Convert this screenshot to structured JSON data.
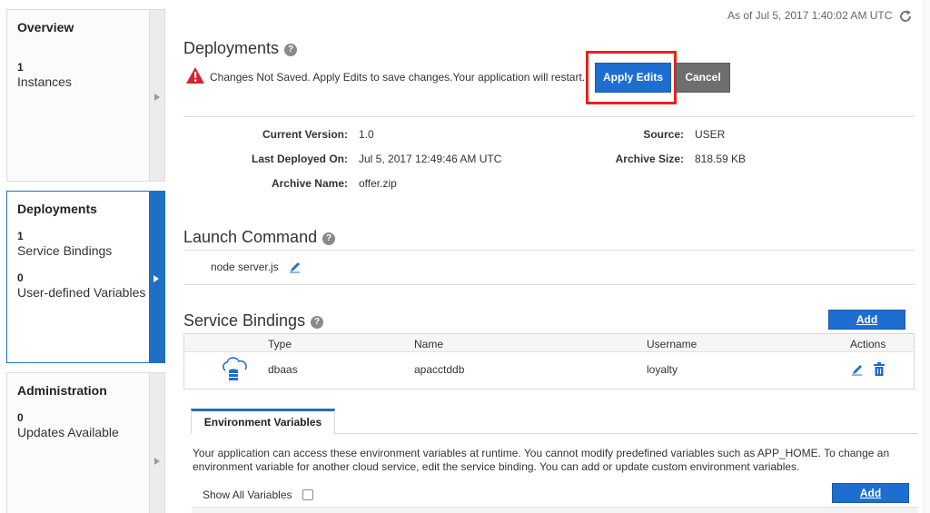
{
  "sidebar": {
    "overview": {
      "title": "Overview",
      "stats": [
        {
          "count": "1",
          "label": "Instances"
        }
      ]
    },
    "deployments": {
      "title": "Deployments",
      "stats": [
        {
          "count": "1",
          "label": "Service Bindings"
        },
        {
          "count": "0",
          "label": "User-defined Variables"
        }
      ]
    },
    "administration": {
      "title": "Administration",
      "stats": [
        {
          "count": "0",
          "label": "Updates Available"
        }
      ]
    }
  },
  "header": {
    "timestamp": "As of Jul 5, 2017 1:40:02 AM UTC",
    "refresh_icon": "refresh-icon"
  },
  "deployments": {
    "title": "Deployments",
    "help": "?",
    "warning_text": "Changes Not Saved. Apply Edits to save changes.Your application will restart.",
    "apply_label": "Apply Edits",
    "cancel_label": "Cancel",
    "details": {
      "current_version_label": "Current Version:",
      "current_version": "1.0",
      "last_deployed_label": "Last Deployed On:",
      "last_deployed": "Jul 5, 2017 12:49:46 AM UTC",
      "archive_name_label": "Archive Name:",
      "archive_name": "offer.zip",
      "source_label": "Source:",
      "source": "USER",
      "archive_size_label": "Archive Size:",
      "archive_size": "818.59 KB"
    }
  },
  "launch": {
    "title": "Launch Command",
    "help": "?",
    "command": "node server.js"
  },
  "service_bindings": {
    "title": "Service Bindings",
    "help": "?",
    "add_label": "Add",
    "columns": {
      "type": "Type",
      "name": "Name",
      "username": "Username",
      "actions": "Actions"
    },
    "rows": [
      {
        "type": "dbaas",
        "name": "apacctddb",
        "username": "loyalty"
      }
    ]
  },
  "env": {
    "tab_label": "Environment Variables",
    "description": "Your application can access these environment variables at runtime. You cannot modify predefined variables such as APP_HOME. To change an environment variable for another cloud service, edit the service binding. You can add or update custom environment variables.",
    "show_all_label": "Show All Variables",
    "show_all_checked": false,
    "add_label": "Add"
  },
  "colors": {
    "accent": "#1e6ed2",
    "highlight": "#e8221a",
    "warning": "#d8232a"
  }
}
